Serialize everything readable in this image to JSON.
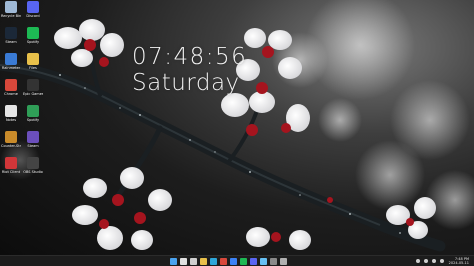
{
  "clock": {
    "time": "07:48:56",
    "day": "Saturday"
  },
  "desktop_icons": [
    {
      "label": "Recycle Bin",
      "icon": "recycle-bin-icon",
      "color": "#9fb9d6"
    },
    {
      "label": "Discord",
      "icon": "discord-icon",
      "color": "#5865f2"
    },
    {
      "label": "Steam",
      "icon": "steam-icon",
      "color": "#1b2838"
    },
    {
      "label": "Spotify",
      "icon": "spotify-icon",
      "color": "#1db954"
    },
    {
      "label": "Rainmeter",
      "icon": "rainmeter-icon",
      "color": "#3a7bd5"
    },
    {
      "label": "Files",
      "icon": "folder-icon",
      "color": "#e8c04a"
    },
    {
      "label": "Chrome",
      "icon": "chrome-icon",
      "color": "#d8483b"
    },
    {
      "label": "Epic Games",
      "icon": "epic-games-icon",
      "color": "#333333"
    },
    {
      "label": "Notes",
      "icon": "file-icon",
      "color": "#e6e6e6"
    },
    {
      "label": "Spotify",
      "icon": "app-icon",
      "color": "#2f9e57"
    },
    {
      "label": "Counter-Strike 2",
      "icon": "cs2-icon",
      "color": "#c98b2a"
    },
    {
      "label": "Steam",
      "icon": "game-icon",
      "color": "#6b4fbb"
    },
    {
      "label": "Riot Client",
      "icon": "riot-icon",
      "color": "#d13639"
    },
    {
      "label": "OBS Studio",
      "icon": "obs-icon",
      "color": "#444444"
    }
  ],
  "taskbar": {
    "apps": [
      {
        "name": "start-button",
        "icon": "windows-logo-icon",
        "color": "#4aa3f0"
      },
      {
        "name": "search-button",
        "icon": "search-icon",
        "color": "#e0e0e0"
      },
      {
        "name": "task-view-button",
        "icon": "task-view-icon",
        "color": "#cfcfcf"
      },
      {
        "name": "file-explorer-button",
        "icon": "folder-icon",
        "color": "#e8c04a"
      },
      {
        "name": "edge-button",
        "icon": "edge-icon",
        "color": "#2ea6d9"
      },
      {
        "name": "chrome-button",
        "icon": "chrome-icon",
        "color": "#d8483b"
      },
      {
        "name": "store-button",
        "icon": "store-icon",
        "color": "#3b82f6"
      },
      {
        "name": "spotify-button",
        "icon": "spotify-icon",
        "color": "#1db954"
      },
      {
        "name": "discord-button",
        "icon": "discord-icon",
        "color": "#5865f2"
      },
      {
        "name": "steam-button",
        "icon": "steam-icon",
        "color": "#66c0f4"
      },
      {
        "name": "obs-button",
        "icon": "obs-icon",
        "color": "#8a8a8a"
      },
      {
        "name": "settings-button",
        "icon": "gear-icon",
        "color": "#b0b0b0"
      }
    ],
    "tray_time": "7:48 PM",
    "tray_date": "2024-05-11"
  }
}
